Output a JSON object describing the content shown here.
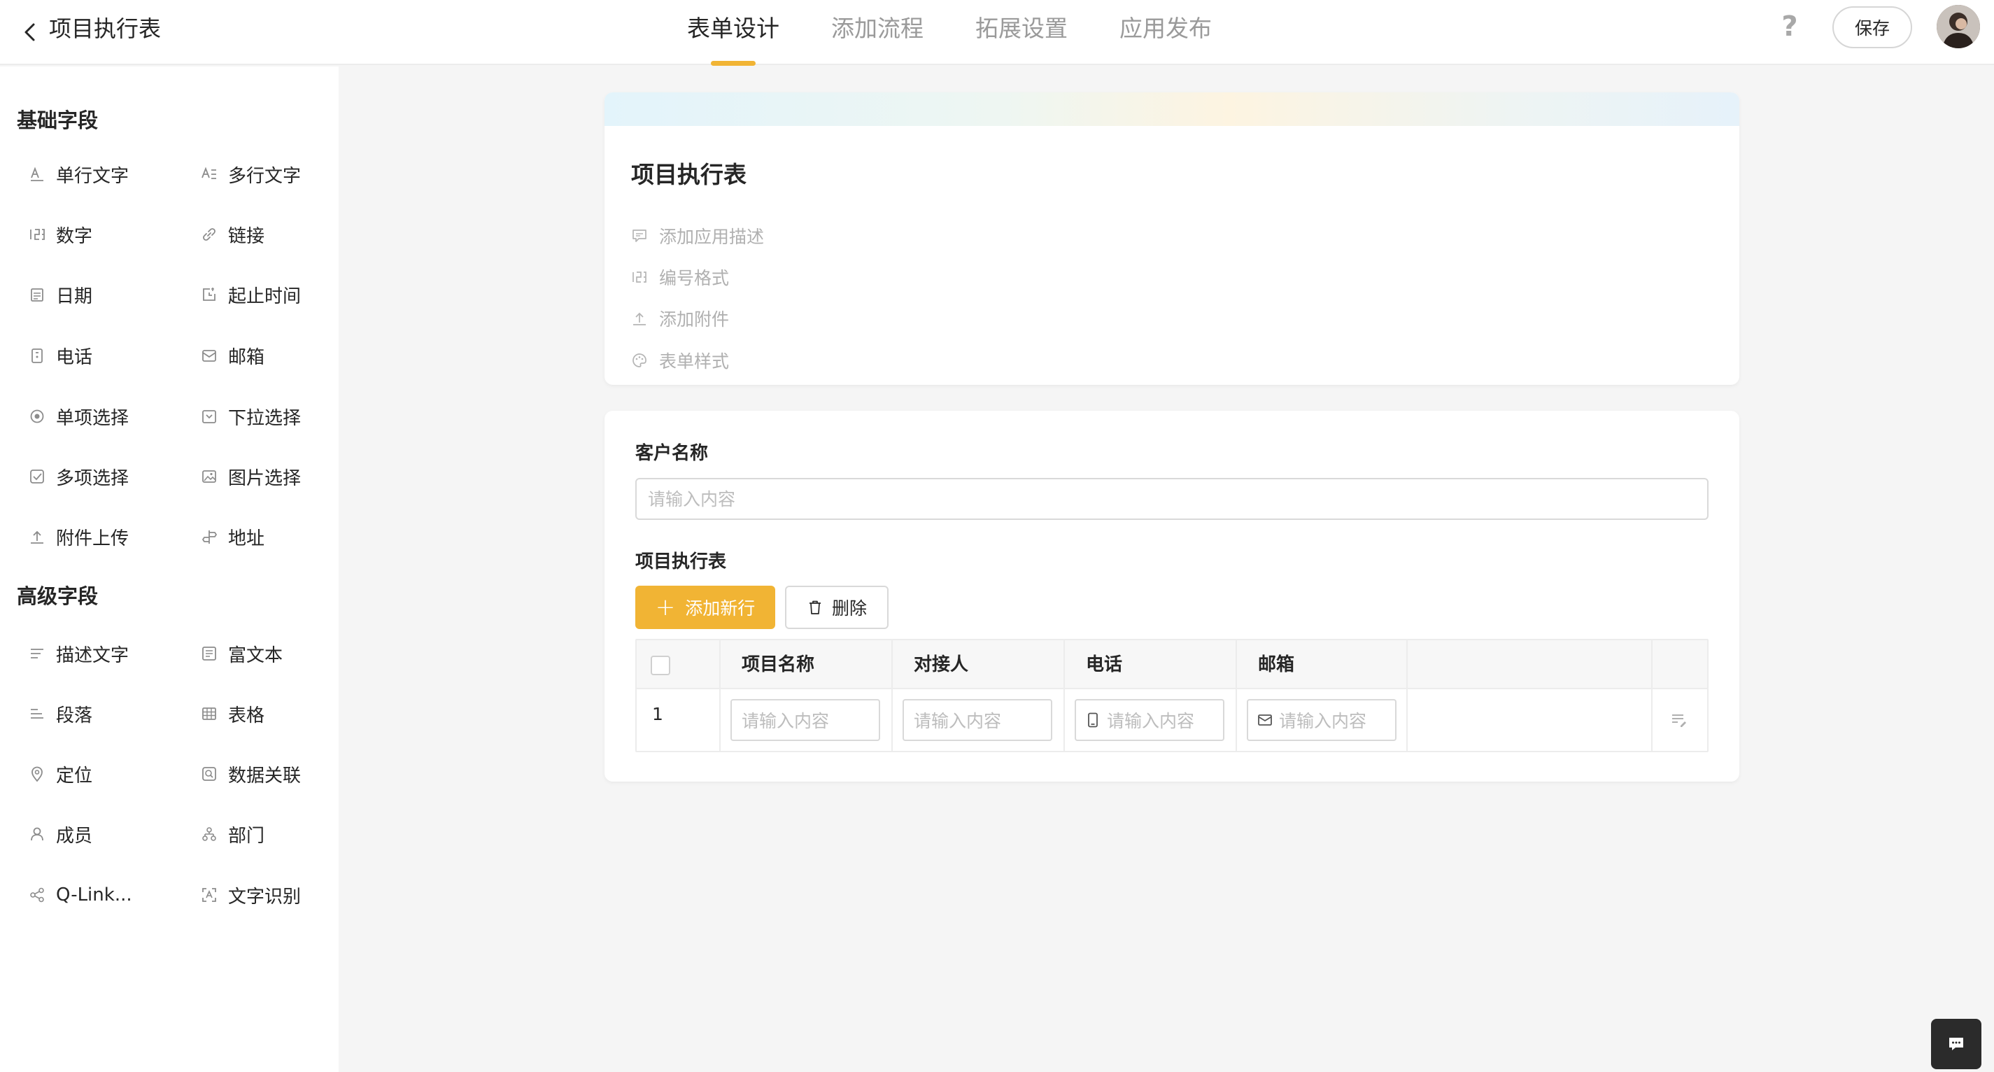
{
  "header": {
    "title": "项目执行表",
    "tabs": [
      {
        "label": "表单设计",
        "active": true
      },
      {
        "label": "添加流程",
        "active": false
      },
      {
        "label": "拓展设置",
        "active": false
      },
      {
        "label": "应用发布",
        "active": false
      }
    ],
    "help_label": "?",
    "save_label": "保存"
  },
  "sidebar": {
    "basic_title": "基础字段",
    "basic_fields": [
      {
        "label": "单行文字",
        "icon": "single-line-text-icon"
      },
      {
        "label": "多行文字",
        "icon": "multi-line-text-icon"
      },
      {
        "label": "数字",
        "icon": "number-icon"
      },
      {
        "label": "链接",
        "icon": "link-icon"
      },
      {
        "label": "日期",
        "icon": "date-icon"
      },
      {
        "label": "起止时间",
        "icon": "time-range-icon"
      },
      {
        "label": "电话",
        "icon": "phone-icon"
      },
      {
        "label": "邮箱",
        "icon": "mail-icon"
      },
      {
        "label": "单项选择",
        "icon": "radio-icon"
      },
      {
        "label": "下拉选择",
        "icon": "dropdown-icon"
      },
      {
        "label": "多项选择",
        "icon": "checkbox-icon"
      },
      {
        "label": "图片选择",
        "icon": "image-icon"
      },
      {
        "label": "附件上传",
        "icon": "upload-icon"
      },
      {
        "label": "地址",
        "icon": "signpost-icon"
      }
    ],
    "advanced_title": "高级字段",
    "advanced_fields": [
      {
        "label": "描述文字",
        "icon": "description-icon"
      },
      {
        "label": "富文本",
        "icon": "rich-text-icon"
      },
      {
        "label": "段落",
        "icon": "paragraph-icon"
      },
      {
        "label": "表格",
        "icon": "table-icon"
      },
      {
        "label": "定位",
        "icon": "location-icon"
      },
      {
        "label": "数据关联",
        "icon": "data-link-icon"
      },
      {
        "label": "成员",
        "icon": "member-icon"
      },
      {
        "label": "部门",
        "icon": "department-icon"
      },
      {
        "label": "Q-Link...",
        "icon": "share-icon"
      },
      {
        "label": "文字识别",
        "icon": "ocr-icon"
      }
    ]
  },
  "form_header": {
    "title": "项目执行表",
    "options": [
      {
        "label": "添加应用描述",
        "icon": "comment-icon"
      },
      {
        "label": "编号格式",
        "icon": "number-icon"
      },
      {
        "label": "添加附件",
        "icon": "upload-icon"
      },
      {
        "label": "表单样式",
        "icon": "palette-icon"
      }
    ]
  },
  "form": {
    "customer_label": "客户名称",
    "customer_placeholder": "请输入内容",
    "table_label": "项目执行表",
    "add_row_label": "添加新行",
    "delete_label": "删除",
    "columns": [
      "项目名称",
      "对接人",
      "电话",
      "邮箱"
    ],
    "row": {
      "index": "1",
      "placeholders": [
        "请输入内容",
        "请输入内容",
        "请输入内容",
        "请输入内容"
      ]
    }
  },
  "colors": {
    "accent": "#f1b434",
    "text": "#262626",
    "muted": "#9a9a9a",
    "placeholder": "#bdbdbd"
  }
}
